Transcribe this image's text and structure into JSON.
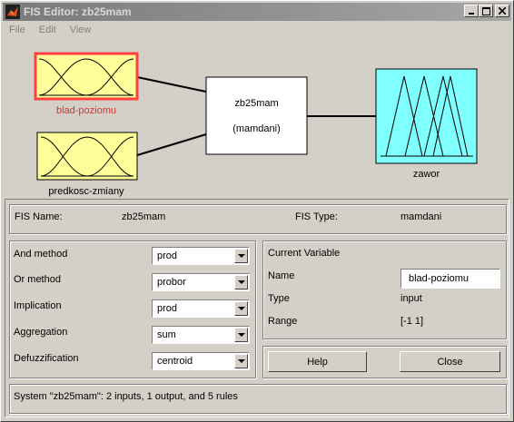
{
  "window": {
    "title": "FIS Editor: zb25mam"
  },
  "menu": [
    "File",
    "Edit",
    "View"
  ],
  "diagram": {
    "inputs": [
      {
        "label": "blad-poziomu",
        "selected": true
      },
      {
        "label": "predkosc-zmiany",
        "selected": false
      }
    ],
    "system": {
      "name": "zb25mam",
      "type": "(mamdani)"
    },
    "output": {
      "label": "zawor"
    }
  },
  "fis_info": {
    "name_label": "FIS Name:",
    "name_value": "zb25mam",
    "type_label": "FIS Type:",
    "type_value": "mamdani"
  },
  "methods": [
    {
      "label": "And method",
      "value": "prod",
      "key": "and"
    },
    {
      "label": "Or method",
      "value": "probor",
      "key": "or"
    },
    {
      "label": "Implication",
      "value": "prod",
      "key": "implication"
    },
    {
      "label": "Aggregation",
      "value": "sum",
      "key": "aggregation"
    },
    {
      "label": "Defuzzification",
      "value": "centroid",
      "key": "defuzzification"
    }
  ],
  "current_variable": {
    "title": "Current Variable",
    "name_label": "Name",
    "name_value": "blad-poziomu",
    "type_label": "Type",
    "type_value": "input",
    "range_label": "Range",
    "range_value": "[-1 1]"
  },
  "buttons": {
    "help": "Help",
    "close": "Close"
  },
  "status": "System \"zb25mam\": 2 inputs, 1 output, and 5 rules",
  "colors": {
    "input_box": "#ffff99",
    "output_box": "#80ffff",
    "selected_border": "#ff4040",
    "selected_label": "#e03030",
    "face": "#d4d0c8"
  }
}
